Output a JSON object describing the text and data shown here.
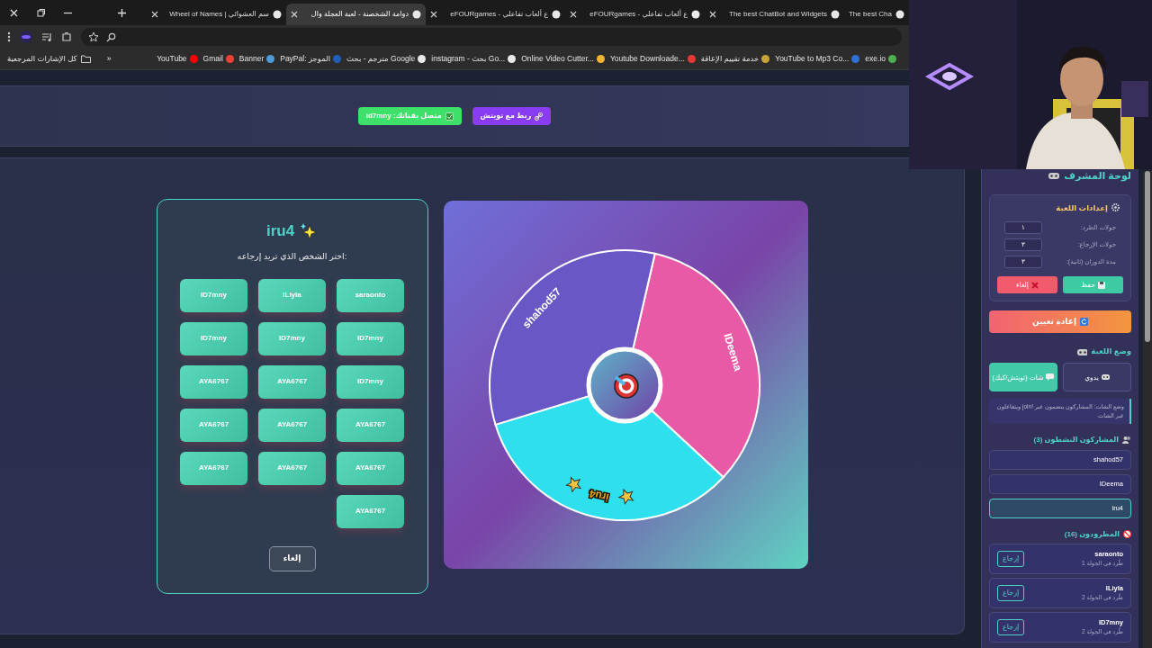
{
  "tabs": [
    {
      "title": "The best Cha",
      "selected": false
    },
    {
      "title": "The best ChatBot and Widgets",
      "selected": false
    },
    {
      "title": "eFOURgames - ع ألعاب تفاعلي",
      "selected": false
    },
    {
      "title": "eFOURgames - ع ألعاب تفاعلي",
      "selected": false
    },
    {
      "title": "دوامة الشخصنة - لعبة العجلة وال",
      "selected": true
    },
    {
      "title": "Wheel of Names | سم العشوائي",
      "selected": false
    }
  ],
  "bookmarks_folder": "كل الإشارات المرجعية",
  "bookmarks_overflow": "»",
  "bookmarks": [
    {
      "label": "exe.io",
      "color": "#4caf50"
    },
    {
      "label": "YouTube to Mp3 Co...",
      "color": "#2f6fd6"
    },
    {
      "label": "خدمة تقييم الإعاقة",
      "color": "#c9a33a"
    },
    {
      "label": "Youtube Downloade...",
      "color": "#e53935"
    },
    {
      "label": "Online Video Cutter...",
      "color": "#f2b233"
    },
    {
      "label": "instagram - بحث Go...",
      "color": "#e8e8e8"
    },
    {
      "label": "مترجم - بحث Google",
      "color": "#e8e8e8"
    },
    {
      "label": "PayPal: الموجز",
      "color": "#1f5fb8"
    },
    {
      "label": "Banner",
      "color": "#4a9bd8"
    },
    {
      "label": "Gmail",
      "color": "#ea4335"
    },
    {
      "label": "YouTube",
      "color": "#ff0000"
    }
  ],
  "header_buttons": [
    {
      "label": "ربط مع تويتش",
      "kind": "connect"
    },
    {
      "label": "متصل بقناتك: id7mny",
      "kind": "status"
    }
  ],
  "return_card": {
    "title": "iru4",
    "prompt": "اختر الشخص الذي تريد إرجاعه:",
    "options": [
      "saraonto",
      "ILiyla",
      "ID7mny",
      "ID7mny",
      "ID7mny",
      "ID7mny",
      "ID7mny",
      "AYA6767",
      "AYA6767",
      "AYA6767",
      "AYA6767",
      "AYA6767",
      "AYA6767",
      "AYA6767",
      "AYA6767",
      "AYA6767"
    ],
    "cancel": "إلغاء"
  },
  "wheel": {
    "segments": [
      {
        "label": "IDeema",
        "color": "#e95aa6",
        "selected": false
      },
      {
        "label": "iru4",
        "color": "#2ee0ee",
        "selected": true
      },
      {
        "label": "shahod57",
        "color": "#6a57c6",
        "selected": false
      }
    ]
  },
  "sidebar": {
    "title": "لوحة المشرف",
    "settings": {
      "title": "إعدادات اللعبة",
      "fields": [
        {
          "label": "جولات الطرد:",
          "value": "١"
        },
        {
          "label": "جولات الإرجاع:",
          "value": "٣"
        },
        {
          "label": "مدة الدوران (ثانية):",
          "value": "٣"
        }
      ],
      "save": "حفظ",
      "cancel": "إلغاء"
    },
    "reset": "إعادة تعيين",
    "mode": {
      "title": "وضع اللعبة",
      "options": [
        {
          "label": "يدوي",
          "kind": "manual",
          "selected": false
        },
        {
          "label": "شات (تويتش/كيك)",
          "kind": "chat",
          "selected": true
        }
      ],
      "note": "وضع الشات: المشاركون ينضمون عبر !join ويتفاعلون عبر الشات"
    },
    "active": {
      "title": "المشاركون النشطون (3)",
      "players": [
        {
          "name": "shahod57",
          "selected": false
        },
        {
          "name": "IDeema",
          "selected": false
        },
        {
          "name": "iru4",
          "selected": true
        }
      ]
    },
    "eliminated": {
      "title": "المطرودون (16)",
      "players": [
        {
          "name": "saraonto",
          "detail": "طُرد في الجولة 1",
          "action": "إرجاع"
        },
        {
          "name": "ILiyla",
          "detail": "طُرد في الجولة 2",
          "action": "إرجاع"
        },
        {
          "name": "ID7mny",
          "detail": "طُرد في الجولة 2",
          "action": "إرجاع"
        }
      ]
    }
  }
}
